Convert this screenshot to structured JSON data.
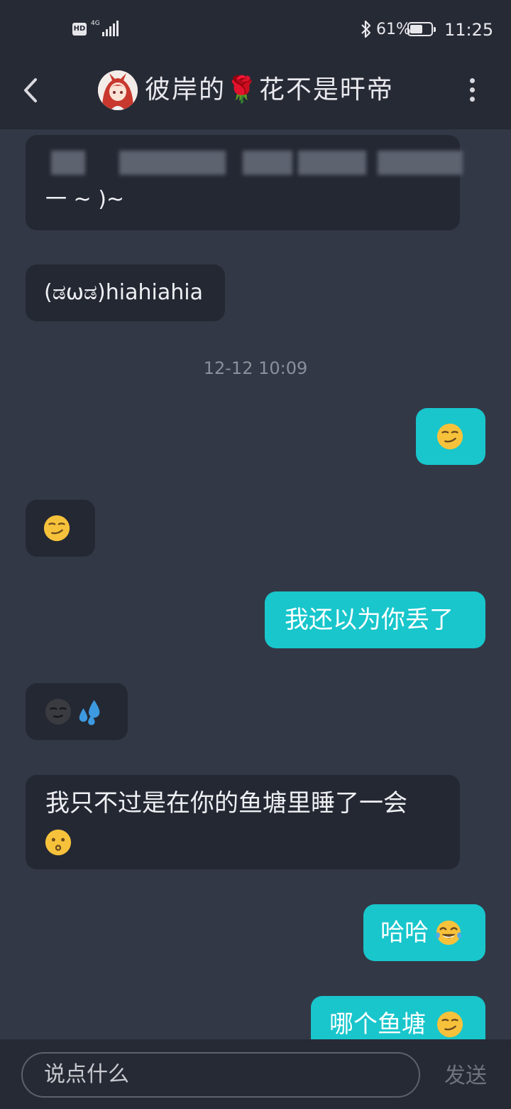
{
  "status_bar": {
    "hd": "HD",
    "network": "4G",
    "battery_percent": "61%",
    "battery_level": 0.61,
    "time": "11:25"
  },
  "header": {
    "title": "彼岸的🌹花不是旰帝",
    "back_icon": "chevron-left-icon",
    "more_icon": "more-vertical-icon"
  },
  "messages": [
    {
      "side": "in",
      "text": "一 ~ )~",
      "blurred_line": true
    },
    {
      "side": "in",
      "text": "(ಡωಡ)hiahiahia"
    },
    {
      "side": "out",
      "emoji": "😏"
    },
    {
      "side": "in",
      "emoji": "😏"
    },
    {
      "side": "out",
      "text": "我还以为你丢了"
    },
    {
      "side": "in",
      "emoji": "🌚💦"
    },
    {
      "side": "in",
      "text": "我只不过是在你的鱼塘里睡了一会",
      "emoji": "😗"
    },
    {
      "side": "out",
      "text": "哈哈",
      "emoji": "😂"
    },
    {
      "side": "out",
      "text": "哪个鱼塘",
      "emoji": "😏"
    }
  ],
  "timestamp": "12-12 10:09",
  "input": {
    "placeholder": "说点什么",
    "send_label": "发送"
  },
  "colors": {
    "background": "#333846",
    "bar": "#262a35",
    "incoming_bubble": "#242833",
    "outgoing_bubble": "#18c6cc"
  }
}
